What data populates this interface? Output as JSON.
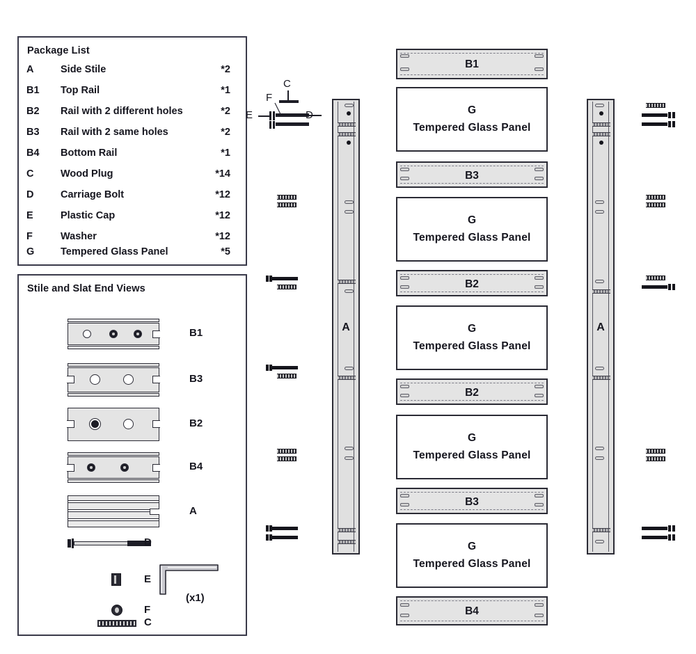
{
  "package_list": {
    "title": "Package List",
    "rows": [
      {
        "code": "A",
        "name": "Side Stile",
        "qty": "*2"
      },
      {
        "code": "B1",
        "name": "Top Rail",
        "qty": "*1"
      },
      {
        "code": "B2",
        "name": "Rail with 2 different holes",
        "qty": "*2"
      },
      {
        "code": "B3",
        "name": "Rail with 2 same holes",
        "qty": "*2"
      },
      {
        "code": "B4",
        "name": "Bottom Rail",
        "qty": "*1"
      },
      {
        "code": "C",
        "name": "Wood Plug",
        "qty": "*14"
      },
      {
        "code": "D",
        "name": "Carriage Bolt",
        "qty": "*12"
      },
      {
        "code": "E",
        "name": "Plastic Cap",
        "qty": "*12"
      },
      {
        "code": "F",
        "name": "Washer",
        "qty": "*12"
      },
      {
        "code": "G",
        "name": "Tempered Glass Panel",
        "qty": "*5"
      }
    ]
  },
  "end_views": {
    "title": "Stile and Slat End Views",
    "items": [
      {
        "label": "B1"
      },
      {
        "label": "B3"
      },
      {
        "label": "B2"
      },
      {
        "label": "B4"
      },
      {
        "label": "A"
      },
      {
        "label": "D"
      },
      {
        "label": "E"
      },
      {
        "label": "F"
      },
      {
        "label": "C"
      }
    ],
    "allen_key_qty": "(x1)"
  },
  "callout": {
    "c": "C",
    "f": "F",
    "e": "E",
    "d": "D"
  },
  "assembly": {
    "left_stile_label": "A",
    "right_stile_label": "A",
    "column": [
      {
        "type": "rail",
        "label": "B1"
      },
      {
        "type": "glass",
        "code": "G",
        "name": "Tempered Glass Panel"
      },
      {
        "type": "rail",
        "label": "B3"
      },
      {
        "type": "glass",
        "code": "G",
        "name": "Tempered Glass Panel"
      },
      {
        "type": "rail",
        "label": "B2"
      },
      {
        "type": "glass",
        "code": "G",
        "name": "Tempered Glass Panel"
      },
      {
        "type": "rail",
        "label": "B2"
      },
      {
        "type": "glass",
        "code": "G",
        "name": "Tempered Glass Panel"
      },
      {
        "type": "rail",
        "label": "B3"
      },
      {
        "type": "glass",
        "code": "G",
        "name": "Tempered Glass Panel"
      },
      {
        "type": "rail",
        "label": "B4"
      }
    ]
  },
  "colors": {
    "outline": "#2b2b35",
    "rail_fill": "#e4e4e4",
    "stile_fill": "#e0e0e0",
    "glass_fill": "#ffffff",
    "text": "#16161f"
  }
}
